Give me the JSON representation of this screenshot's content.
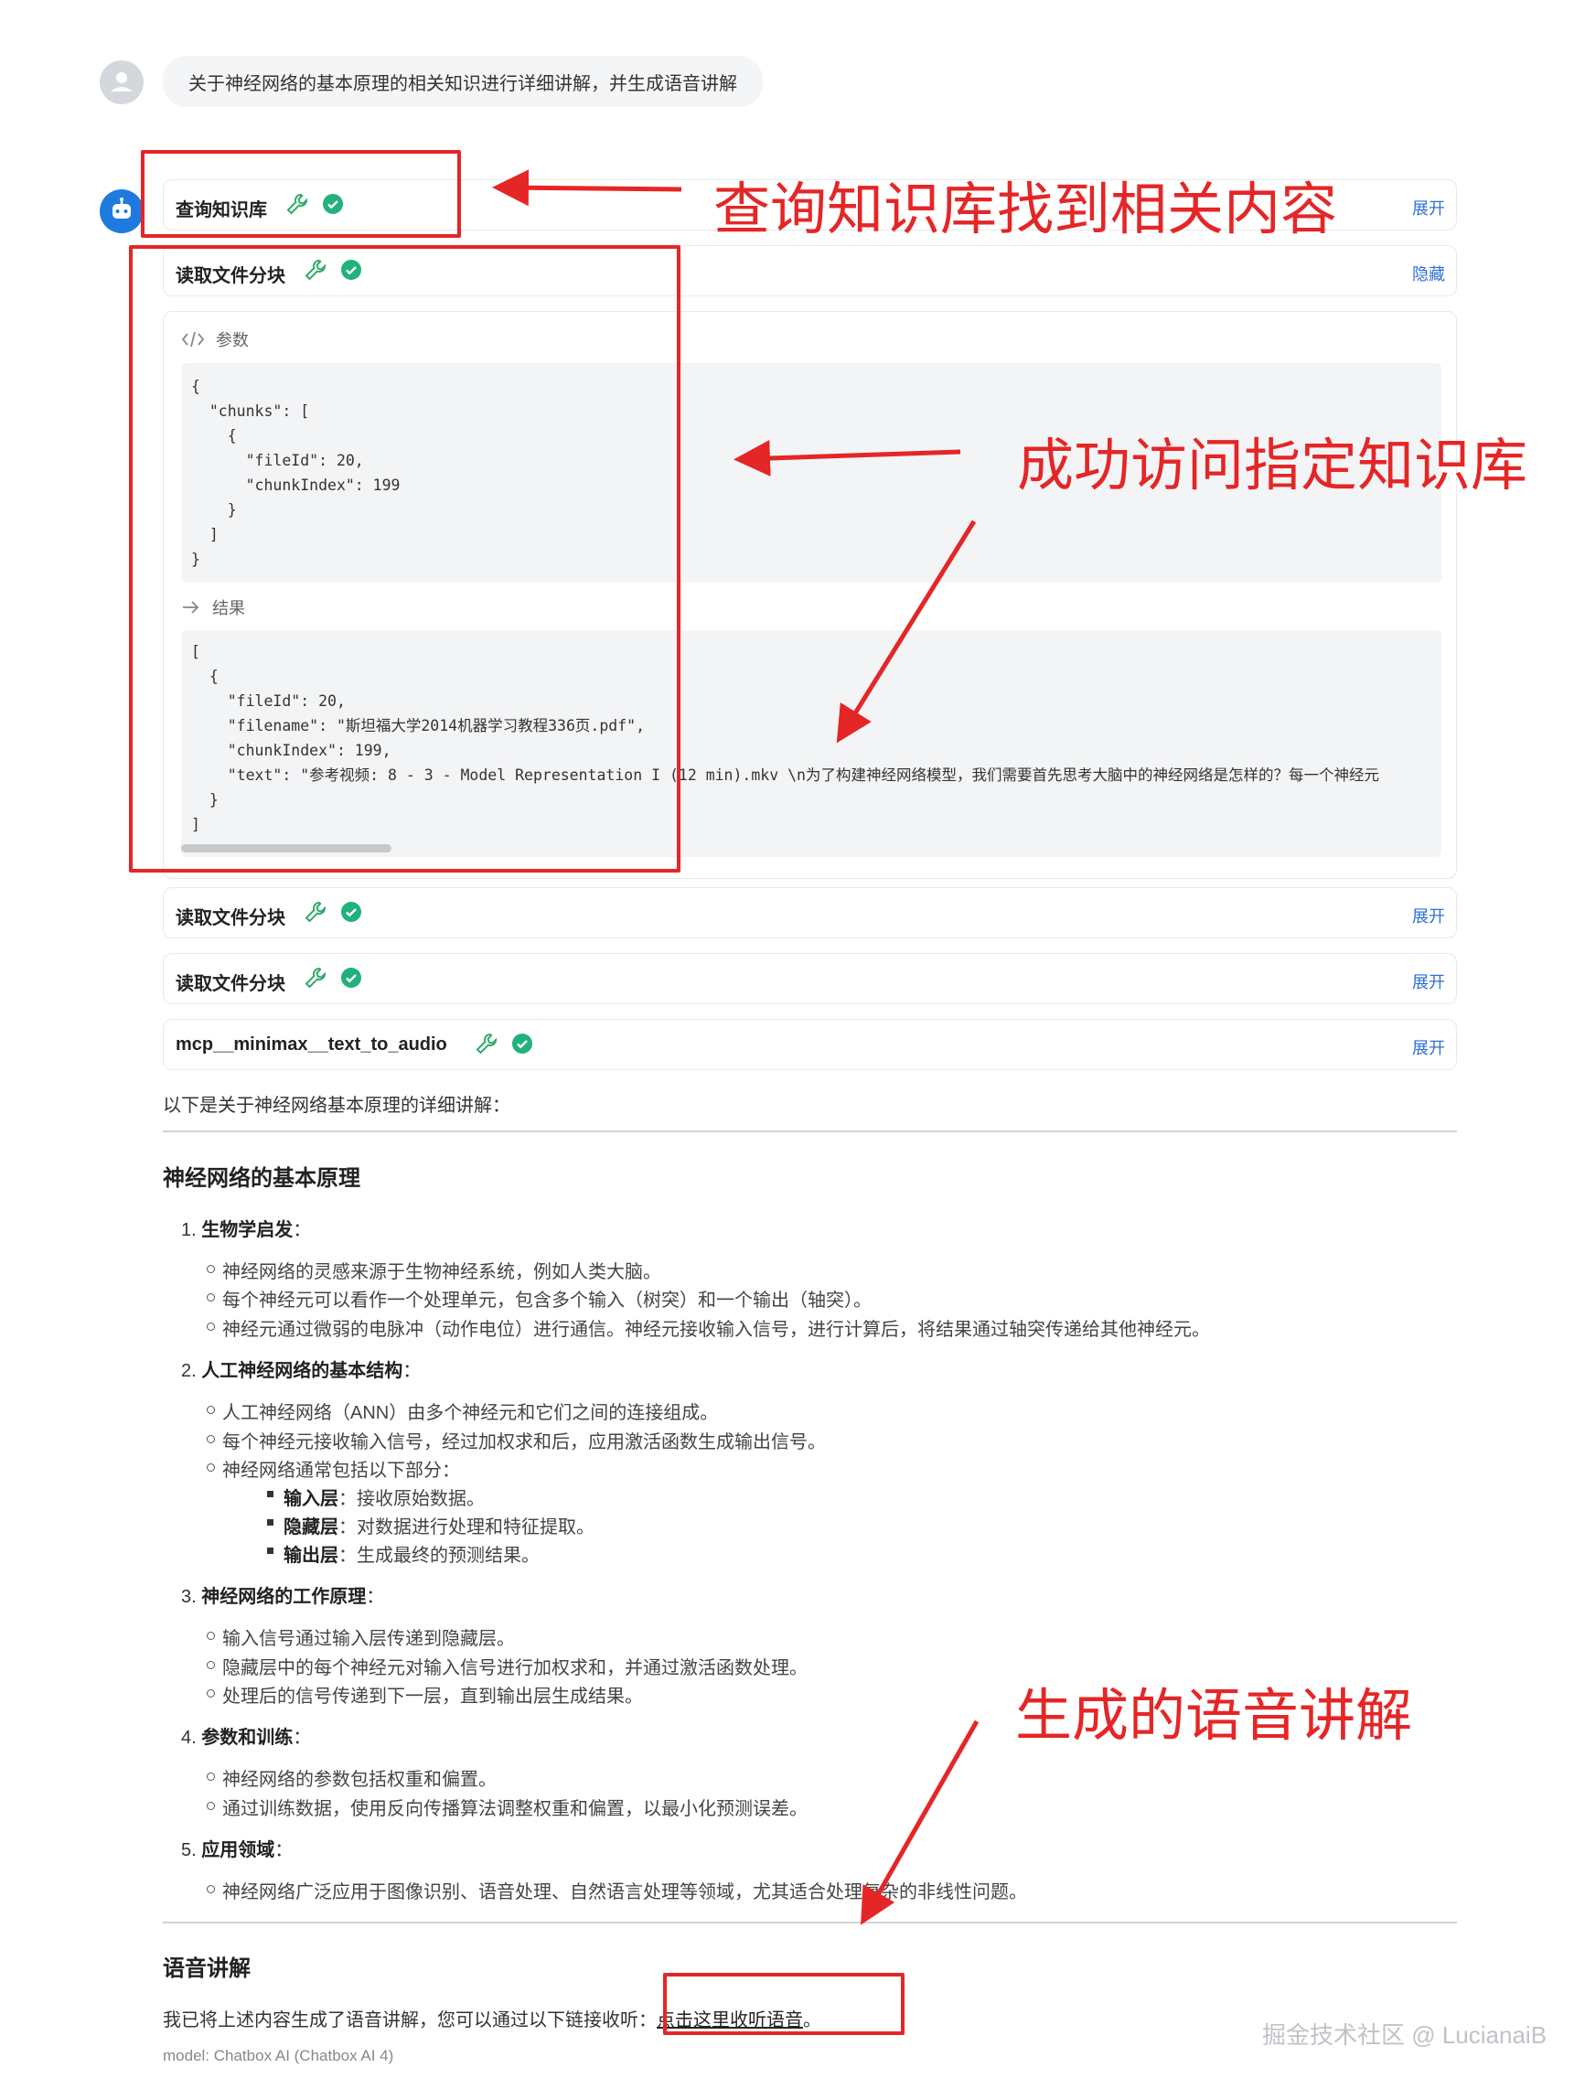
{
  "user_message": "关于神经网络的基本原理的相关知识进行详细讲解，并生成语音讲解",
  "tools": [
    {
      "name": "查询知识库",
      "toggle": "展开"
    },
    {
      "name": "读取文件分块",
      "toggle": "隐藏"
    },
    {
      "name": "读取文件分块",
      "toggle": "展开"
    },
    {
      "name": "读取文件分块",
      "toggle": "展开"
    },
    {
      "name": "mcp__minimax__text_to_audio",
      "toggle": "展开"
    }
  ],
  "panel": {
    "params_label": "参数",
    "params_code": "{\n  \"chunks\": [\n    {\n      \"fileId\": 20,\n      \"chunkIndex\": 199\n    }\n  ]\n}",
    "result_label": "结果",
    "result_code": "[\n  {\n    \"fileId\": 20,\n    \"filename\": \"斯坦福大学2014机器学习教程336页.pdf\",\n    \"chunkIndex\": 199,\n    \"text\": \"参考视频: 8 - 3 - Model Representation I (12 min).mkv \\n为了构建神经网络模型，我们需要首先思考大脑中的神经网络是怎样的？每一个神经元\n  }\n]"
  },
  "article": {
    "intro": "以下是关于神经网络基本原理的详细讲解：",
    "heading": "神经网络的基本原理",
    "sections": [
      {
        "num": "1.",
        "title": "生物学启发",
        "items": [
          "神经网络的灵感来源于生物神经系统，例如人类大脑。",
          "每个神经元可以看作一个处理单元，包含多个输入（树突）和一个输出（轴突）。",
          "神经元通过微弱的电脉冲（动作电位）进行通信。神经元接收输入信号，进行计算后，将结果通过轴突传递给其他神经元。"
        ]
      },
      {
        "num": "2.",
        "title": "人工神经网络的基本结构",
        "items": [
          "人工神经网络（ANN）由多个神经元和它们之间的连接组成。",
          "每个神经元接收输入信号，经过加权求和后，应用激活函数生成输出信号。",
          "神经网络通常包括以下部分："
        ],
        "sub": [
          {
            "term": "输入层",
            "desc": "：接收原始数据。"
          },
          {
            "term": "隐藏层",
            "desc": "：对数据进行处理和特征提取。"
          },
          {
            "term": "输出层",
            "desc": "：生成最终的预测结果。"
          }
        ]
      },
      {
        "num": "3.",
        "title": "神经网络的工作原理",
        "items": [
          "输入信号通过输入层传递到隐藏层。",
          "隐藏层中的每个神经元对输入信号进行加权求和，并通过激活函数处理。",
          "处理后的信号传递到下一层，直到输出层生成结果。"
        ]
      },
      {
        "num": "4.",
        "title": "参数和训练",
        "items": [
          "神经网络的参数包括权重和偏置。",
          "通过训练数据，使用反向传播算法调整权重和偏置，以最小化预测误差。"
        ]
      },
      {
        "num": "5.",
        "title": "应用领域",
        "items": [
          "神经网络广泛应用于图像识别、语音处理、自然语言处理等领域，尤其适合处理复杂的非线性问题。"
        ]
      }
    ],
    "voice_heading": "语音讲解",
    "voice_text": "我已将上述内容生成了语音讲解，您可以通过以下链接收听：",
    "voice_link": "点击这里收听语音",
    "voice_end": "。",
    "model": "model: Chatbox AI (Chatbox AI 4)"
  },
  "annotations": {
    "a1": "查询知识库找到相关内容",
    "a2": "成功访问指定知识库",
    "a3": "生成的语音讲解"
  },
  "watermark": "掘金技术社区 @ LucianaiB",
  "colors": {
    "accent": "#2f6fd6",
    "annotation": "#e52626",
    "check": "#20b27a",
    "wrench": "#2faa6a"
  }
}
